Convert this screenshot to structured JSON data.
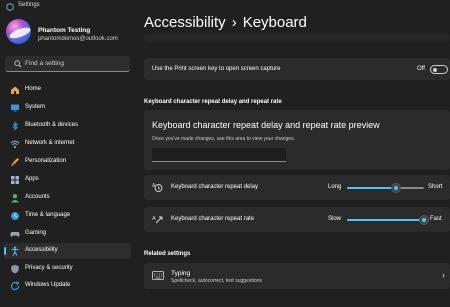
{
  "window": {
    "title": "Settings"
  },
  "user": {
    "name": "Phantom Testing",
    "email": "phantomdemos@outlook.com"
  },
  "search": {
    "placeholder": "Find a setting"
  },
  "sidebar": {
    "items": [
      {
        "label": "Home",
        "icon": "home-icon"
      },
      {
        "label": "System",
        "icon": "monitor-icon"
      },
      {
        "label": "Bluetooth & devices",
        "icon": "bluetooth-icon"
      },
      {
        "label": "Network & internet",
        "icon": "wifi-icon"
      },
      {
        "label": "Personalization",
        "icon": "brush-icon"
      },
      {
        "label": "Apps",
        "icon": "apps-icon"
      },
      {
        "label": "Accounts",
        "icon": "person-icon"
      },
      {
        "label": "Time & language",
        "icon": "globe-clock-icon"
      },
      {
        "label": "Gaming",
        "icon": "gamepad-icon"
      },
      {
        "label": "Accessibility",
        "icon": "accessibility-icon",
        "active": true
      },
      {
        "label": "Privacy & security",
        "icon": "shield-icon"
      },
      {
        "label": "Windows Update",
        "icon": "refresh-icon"
      }
    ]
  },
  "breadcrumb": {
    "parent": "Accessibility",
    "separator": "›",
    "current": "Keyboard"
  },
  "print_screen": {
    "label": "Use the Print screen key to open screen capture",
    "state": "Off"
  },
  "repeat_section": {
    "header": "Keyboard character repeat delay and repeat rate",
    "preview_title": "Keyboard character repeat delay and repeat rate preview",
    "preview_hint": "Once you've made changes, use this area to view your changes."
  },
  "repeat_delay": {
    "label": "Keyboard character repeat delay",
    "min_label": "Long",
    "max_label": "Short",
    "level": 0.63
  },
  "repeat_rate": {
    "label": "Keyboard character repeat rate",
    "min_label": "Slow",
    "max_label": "Fast",
    "level": 1.0
  },
  "related": {
    "header": "Related settings",
    "typing_title": "Typing",
    "typing_subtitle": "Spellcheck, autocorrect, text suggestions"
  },
  "colors": {
    "accent": "#4cc2ff",
    "background": "#202020",
    "card": "#2b2b2b"
  }
}
